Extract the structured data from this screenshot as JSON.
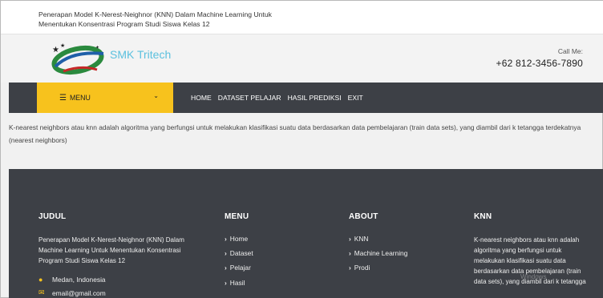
{
  "topbar": {
    "title": "Penerapan Model K-Nerest-Neighnor (KNN) Dalam Machine Learning Untuk Menentukan Konsentrasi Program Studi Siswa Kelas 12"
  },
  "header": {
    "brand": "SMK Tritech",
    "call_label": "Call Me:",
    "phone": "+62 812-3456-7890"
  },
  "nav": {
    "menu_label": "MENU",
    "hamburger_icon": "☰",
    "chevron_icon": "⌄",
    "links": [
      "HOME",
      "DATASET PELAJAR",
      "HASIL PREDIKSI",
      "EXIT"
    ]
  },
  "content": {
    "text": "K-nearest neighbors atau knn adalah algoritma yang berfungsi untuk melakukan klasifikasi suatu data berdasarkan data pembelajaran (train data sets), yang diambil dari k tetangga terdekatnya (nearest neighbors)"
  },
  "footer": {
    "judul": {
      "heading": "JUDUL",
      "text": "Penerapan Model K-Nerest-Neighnor (KNN) Dalam Machine Learning Untuk Menentukan Konsentrasi Program Studi Siswa Kelas 12",
      "location": "Medan, Indonesia",
      "email": "email@gmail.com"
    },
    "menu": {
      "heading": "MENU",
      "items": [
        "Home",
        "Dataset",
        "Pelajar",
        "Hasil"
      ]
    },
    "about": {
      "heading": "ABOUT",
      "items": [
        "KNN",
        "Machine Learning",
        "Prodi"
      ]
    },
    "knn": {
      "heading": "KNN",
      "text": "K-nearest neighbors atau knn adalah algoritma yang berfungsi untuk melakukan klasifikasi suatu data berdasarkan data pembelajaran (train data sets), yang diambil dari k tetangga"
    },
    "watermark": "Windows"
  },
  "colors": {
    "accent": "#f7c21d",
    "nav_bg": "#3d4046",
    "brand": "#5bc0de"
  }
}
